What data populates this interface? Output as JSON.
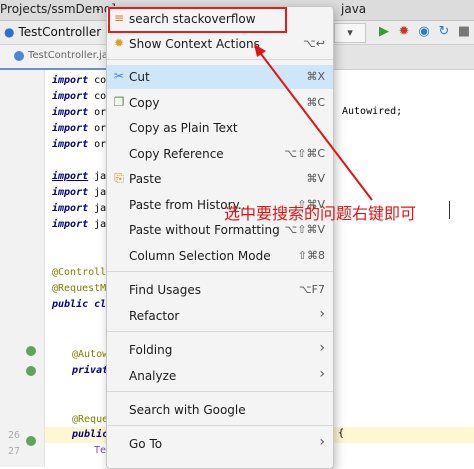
{
  "titlebar": {
    "path": "Projects/ssmDemo]",
    "sep": "-",
    "right_text": "java"
  },
  "navbar": {
    "crumb": "TestController",
    "dropdown": "▾"
  },
  "editor_tab": {
    "label": "TestController.java"
  },
  "line_numbers": [
    "26",
    "27"
  ],
  "code_lines": [
    {
      "kw": "import",
      "rest": "com"
    },
    {
      "kw": "import",
      "rest": "com"
    },
    {
      "kw": "import",
      "rest": "org"
    },
    {
      "kw": "import",
      "rest": "org"
    },
    {
      "kw": "import",
      "rest": "org"
    },
    {
      "kw": "import",
      "rest": "java"
    },
    {
      "kw": "import",
      "rest": "java"
    },
    {
      "kw": "import",
      "rest": "java"
    },
    {
      "kw": "import",
      "rest": "java"
    }
  ],
  "annotations": {
    "controller": "@Controller",
    "request_mapping": "@RequestMapp",
    "class_decl": "public class",
    "autowired": "@Autowi",
    "private": "private",
    "request": "@Reques",
    "public": "public",
    "test": "Tes"
  },
  "right_code": {
    "autowired": "Autowired;",
    "brace": "{"
  },
  "context_menu": {
    "items": [
      {
        "label": "search stackoverflow",
        "shortcut": "",
        "icon": "stackoverflow-icon",
        "glyph": "≡"
      },
      {
        "label": "Show Context Actions",
        "shortcut": "⌥↩",
        "icon": "bulb-icon",
        "glyph": "✹"
      },
      {
        "label": "Cut",
        "shortcut": "⌘X",
        "icon": "cut-icon",
        "glyph": "✂"
      },
      {
        "label": "Copy",
        "shortcut": "⌘C",
        "icon": "copy-icon",
        "glyph": "❐"
      },
      {
        "label": "Copy as Plain Text",
        "shortcut": "",
        "icon": "",
        "glyph": ""
      },
      {
        "label": "Copy Reference",
        "shortcut": "⌥⇧⌘C",
        "icon": "",
        "glyph": ""
      },
      {
        "label": "Paste",
        "shortcut": "⌘V",
        "icon": "paste-icon",
        "glyph": "⎘"
      },
      {
        "label": "Paste from History...",
        "shortcut": "⇧⌘V",
        "icon": "",
        "glyph": ""
      },
      {
        "label": "Paste without Formatting",
        "shortcut": "⌥⇧⌘V",
        "icon": "",
        "glyph": ""
      },
      {
        "label": "Column Selection Mode",
        "shortcut": "⇧⌘8",
        "icon": "",
        "glyph": ""
      },
      {
        "label": "Find Usages",
        "shortcut": "⌥F7",
        "icon": "",
        "glyph": ""
      },
      {
        "label": "Refactor",
        "shortcut": "›",
        "icon": "",
        "glyph": ""
      },
      {
        "label": "Folding",
        "shortcut": "›",
        "icon": "",
        "glyph": ""
      },
      {
        "label": "Analyze",
        "shortcut": "›",
        "icon": "",
        "glyph": ""
      },
      {
        "label": "Search with Google",
        "shortcut": "",
        "icon": "",
        "glyph": ""
      },
      {
        "label": "Go To",
        "shortcut": "›",
        "icon": "",
        "glyph": ""
      }
    ]
  },
  "annotation_text": "选中要搜索的问题右键即可",
  "colors": {
    "highlight": "#cfe6f9",
    "annotation_red": "#e01616",
    "keyword": "#000080",
    "annotation": "#808000"
  }
}
